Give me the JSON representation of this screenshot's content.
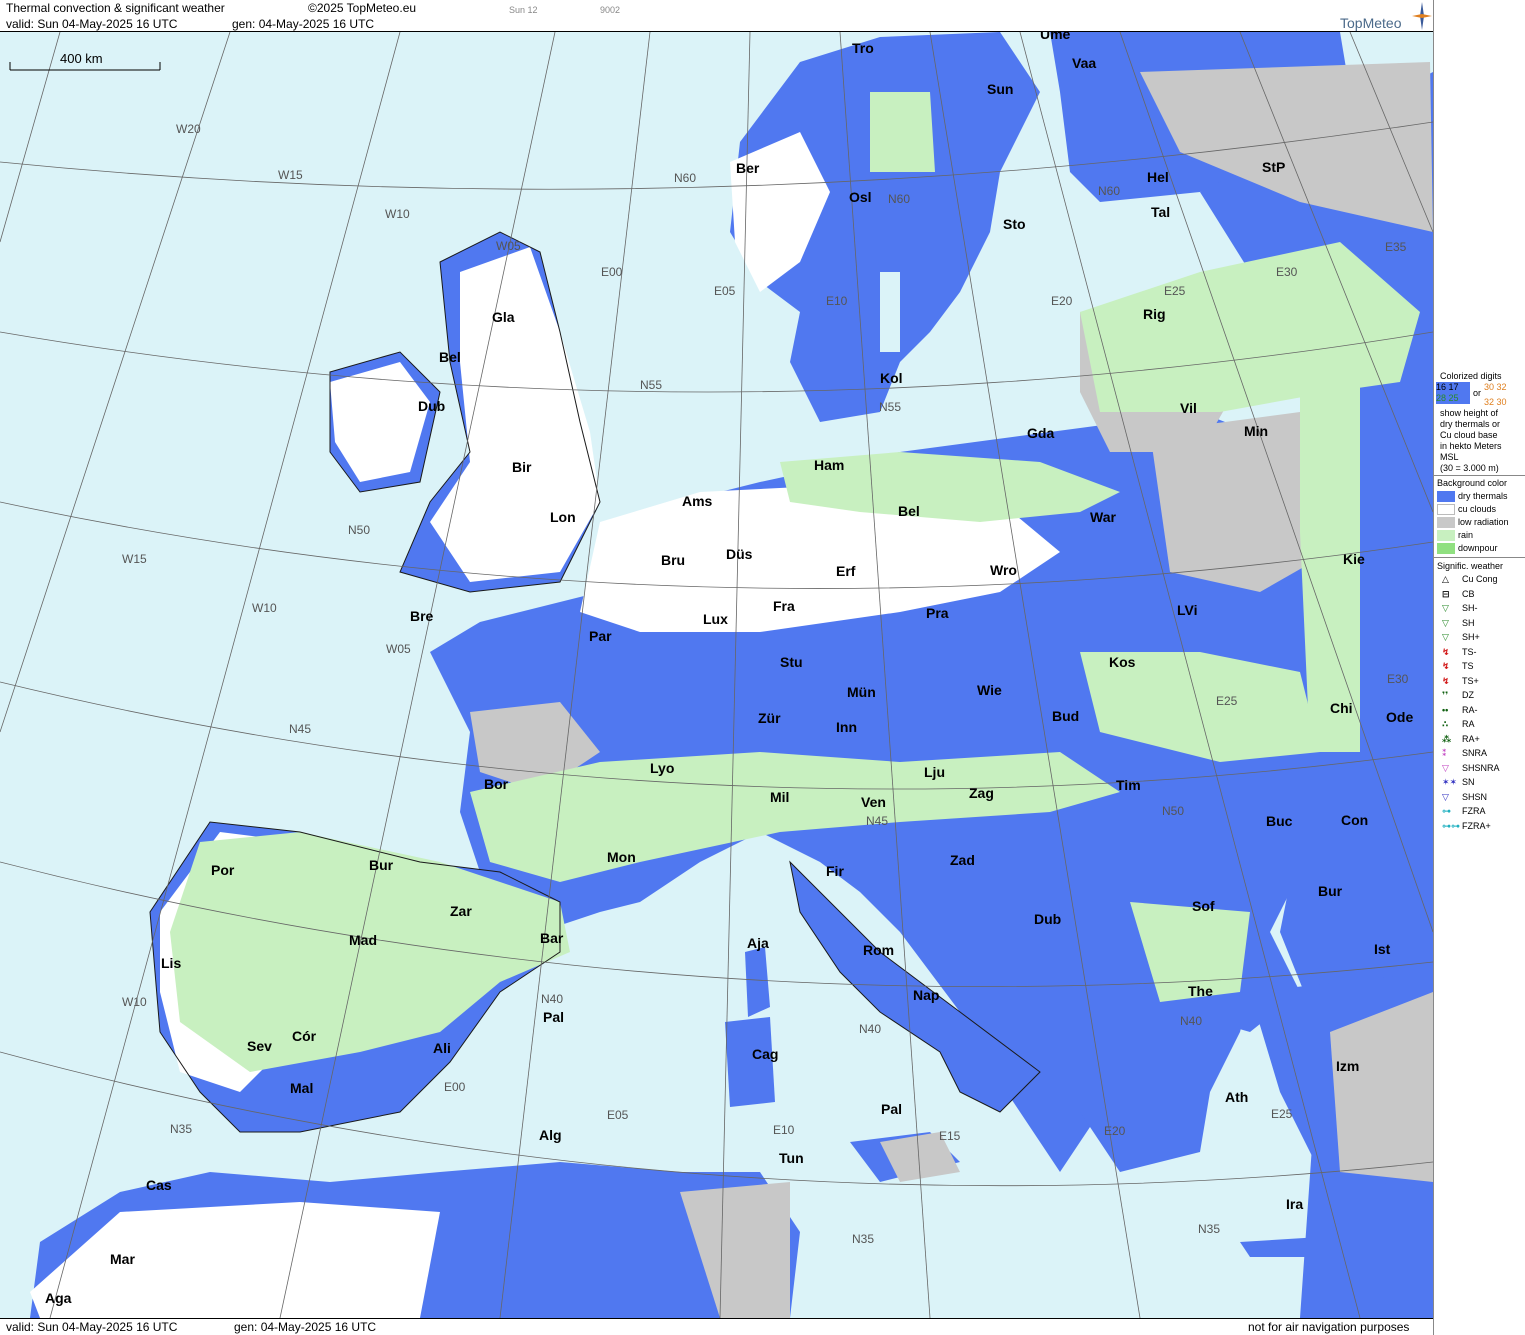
{
  "header": {
    "title": "Thermal convection & significant weather",
    "copyright": "©2025 TopMeteo.eu",
    "valid": "valid:  Sun  04-May-2025  16 UTC",
    "gen": "gen: 04-May-2025 16 UTC",
    "code1": "Sun 12",
    "code2": "9002",
    "logo": "TopMeteo"
  },
  "footer": {
    "valid": "valid:  Sun  04-May-2025  16 UTC",
    "gen": "gen: 04-May-2025 16 UTC",
    "disclaimer": "not for air navigation purposes"
  },
  "scale_label": "400 km",
  "colors": {
    "sea": "#dbf3f8",
    "dry_thermals": "#5078f0",
    "cu_clouds": "#ffffff",
    "low_radiation": "#c8c8c8",
    "rain": "#c8f0c0",
    "downpour": "#90e080"
  },
  "legend": {
    "colorized_title": "Colorized digits",
    "sample_a1": "16 17",
    "sample_a2": "28 25",
    "sample_or": "or",
    "sample_b1": "30 32",
    "sample_b2": "32 30",
    "desc": [
      "show height of",
      "dry thermals or",
      "Cu cloud base",
      "in hekto Meters",
      "MSL",
      "(30 = 3.000 m)"
    ],
    "bg_title": "Background color",
    "bg_items": [
      {
        "label": "dry thermals",
        "color": "#5078f0"
      },
      {
        "label": "cu clouds",
        "color": "#ffffff"
      },
      {
        "label": "low radiation",
        "color": "#c8c8c8"
      },
      {
        "label": "rain",
        "color": "#c8f0c0"
      },
      {
        "label": "downpour",
        "color": "#90e080"
      }
    ],
    "sw_title": "Signific. weather",
    "sw_items": [
      {
        "label": "Cu Cong",
        "symbol": "△",
        "color": "#000000"
      },
      {
        "label": "CB",
        "symbol": "⊟",
        "color": "#000000"
      },
      {
        "label": "SH-",
        "symbol": "▽",
        "color": "#2a8a2a"
      },
      {
        "label": "SH",
        "symbol": "▽",
        "color": "#2a8a2a"
      },
      {
        "label": "SH+",
        "symbol": "▽",
        "color": "#2a8a2a"
      },
      {
        "label": "TS-",
        "symbol": "↯",
        "color": "#d01010"
      },
      {
        "label": "TS",
        "symbol": "↯",
        "color": "#d01010"
      },
      {
        "label": "TS+",
        "symbol": "↯",
        "color": "#d01010"
      },
      {
        "label": "DZ",
        "symbol": "❜❜",
        "color": "#106010"
      },
      {
        "label": "RA-",
        "symbol": "••",
        "color": "#106010"
      },
      {
        "label": "RA",
        "symbol": "∴",
        "color": "#106010"
      },
      {
        "label": "RA+",
        "symbol": "⁂",
        "color": "#106010"
      },
      {
        "label": "SNRA",
        "symbol": "⁑",
        "color": "#c040c0"
      },
      {
        "label": "SHSNRA",
        "symbol": "▽",
        "color": "#c040c0"
      },
      {
        "label": "SN",
        "symbol": "✶✶",
        "color": "#3030c0"
      },
      {
        "label": "SHSN",
        "symbol": "▽",
        "color": "#3030c0"
      },
      {
        "label": "FZRA",
        "symbol": "⊶",
        "color": "#20b0c0"
      },
      {
        "label": "FZRA+",
        "symbol": "⊶⊶",
        "color": "#20b0c0"
      }
    ]
  },
  "grid_labels": [
    "W20",
    "W15",
    "W10",
    "W05",
    "E00",
    "E05",
    "E10",
    "E15",
    "E20",
    "E25",
    "E30",
    "E35",
    "N60",
    "N55",
    "N50",
    "N45",
    "N40",
    "N35",
    "W15",
    "W10",
    "W05",
    "N45",
    "W10",
    "W05",
    "E00",
    "E05",
    "E10",
    "E15",
    "E20",
    "E25",
    "N40",
    "N35",
    "N60",
    "N55",
    "N50",
    "N45",
    "N40",
    "N35",
    "N60",
    "N50",
    "N35",
    "E30",
    "E25",
    "N35"
  ],
  "cities": [
    {
      "name": "Tro"
    },
    {
      "name": "Ume"
    },
    {
      "name": "Vaa"
    },
    {
      "name": "Sun"
    },
    {
      "name": "Ber"
    },
    {
      "name": "Hel"
    },
    {
      "name": "StP"
    },
    {
      "name": "Osl"
    },
    {
      "name": "Tal"
    },
    {
      "name": "Sto"
    },
    {
      "name": "Gla"
    },
    {
      "name": "Rig"
    },
    {
      "name": "Bel"
    },
    {
      "name": "Kol"
    },
    {
      "name": "Dub"
    },
    {
      "name": "Vil"
    },
    {
      "name": "Min"
    },
    {
      "name": "Gda"
    },
    {
      "name": "Ham"
    },
    {
      "name": "Bir"
    },
    {
      "name": "Ams"
    },
    {
      "name": "Lon"
    },
    {
      "name": "Bel"
    },
    {
      "name": "War"
    },
    {
      "name": "Bru"
    },
    {
      "name": "Düs"
    },
    {
      "name": "Erf"
    },
    {
      "name": "Wro"
    },
    {
      "name": "Kie"
    },
    {
      "name": "Bre"
    },
    {
      "name": "Lux"
    },
    {
      "name": "Fra"
    },
    {
      "name": "Pra"
    },
    {
      "name": "LVi"
    },
    {
      "name": "Par"
    },
    {
      "name": "Stu"
    },
    {
      "name": "Kos"
    },
    {
      "name": "Mün"
    },
    {
      "name": "Wie"
    },
    {
      "name": "Chi"
    },
    {
      "name": "Zür"
    },
    {
      "name": "Inn"
    },
    {
      "name": "Bud"
    },
    {
      "name": "Ode"
    },
    {
      "name": "Lyo"
    },
    {
      "name": "Lju"
    },
    {
      "name": "Bor"
    },
    {
      "name": "Mil"
    },
    {
      "name": "Zag"
    },
    {
      "name": "Tim"
    },
    {
      "name": "Ven"
    },
    {
      "name": "Buc"
    },
    {
      "name": "Con"
    },
    {
      "name": "Mon"
    },
    {
      "name": "Por"
    },
    {
      "name": "Bur"
    },
    {
      "name": "Fir"
    },
    {
      "name": "Zad"
    },
    {
      "name": "Bur"
    },
    {
      "name": "Zar"
    },
    {
      "name": "Sof"
    },
    {
      "name": "Dub"
    },
    {
      "name": "Aja"
    },
    {
      "name": "Mad"
    },
    {
      "name": "Bar"
    },
    {
      "name": "Rom"
    },
    {
      "name": "Ist"
    },
    {
      "name": "Lis"
    },
    {
      "name": "The"
    },
    {
      "name": "Nap"
    },
    {
      "name": "Pal"
    },
    {
      "name": "Ali"
    },
    {
      "name": "Cór"
    },
    {
      "name": "Sev"
    },
    {
      "name": "Cag"
    },
    {
      "name": "Izm"
    },
    {
      "name": "Mal"
    },
    {
      "name": "Ath"
    },
    {
      "name": "Pal"
    },
    {
      "name": "Alg"
    },
    {
      "name": "Tun"
    },
    {
      "name": "Cas"
    },
    {
      "name": "Ira"
    },
    {
      "name": "Mar"
    },
    {
      "name": "Aga"
    }
  ]
}
